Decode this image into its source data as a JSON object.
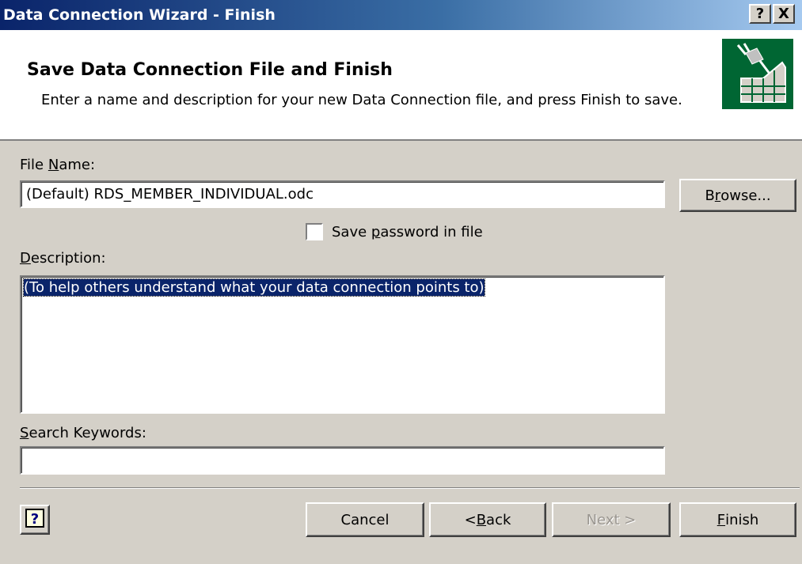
{
  "window": {
    "title": "Data Connection Wizard - Finish",
    "help_button": "?",
    "close_button": "X"
  },
  "header": {
    "title": "Save Data Connection File and Finish",
    "description": "Enter a name and description for your new Data Connection file, and press Finish to save.",
    "icon": "data-connection-icon"
  },
  "form": {
    "file_name": {
      "label_pre": "File ",
      "label_key": "N",
      "label_post": "ame:",
      "value": "(Default) RDS_MEMBER_INDIVIDUAL.odc"
    },
    "browse": {
      "label_pre": "B",
      "label_key": "r",
      "label_post": "owse..."
    },
    "save_password": {
      "label_pre": "Save ",
      "label_key": "p",
      "label_post": "assword in file",
      "checked": false
    },
    "description": {
      "label_key": "D",
      "label_post": "escription:",
      "value": "(To help others understand what your data connection points to)"
    },
    "search_keywords": {
      "label_key": "S",
      "label_post": "earch Keywords:",
      "value": ""
    }
  },
  "footer": {
    "help_icon": "help-question-icon",
    "cancel": "Cancel",
    "back_pre": "< ",
    "back_key": "B",
    "back_post": "ack",
    "next": "Next >",
    "finish_key": "F",
    "finish_post": "inish"
  },
  "colors": {
    "titlebar_start": "#0a246a",
    "titlebar_end": "#a6caf0",
    "dialog_face": "#d4d0c8",
    "selection": "#0a246a",
    "icon_background": "#006633"
  }
}
